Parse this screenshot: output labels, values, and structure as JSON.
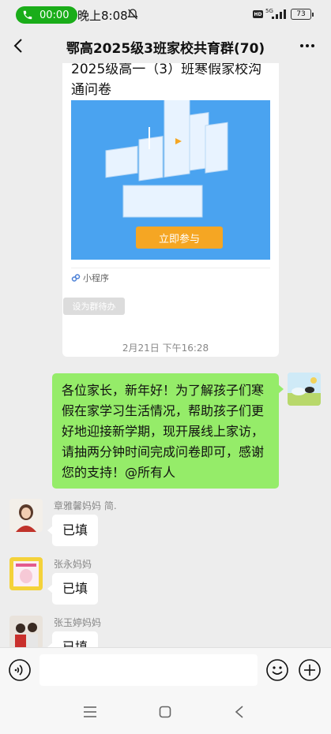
{
  "status_bar": {
    "call_timer": "00:00",
    "time": "晚上8:08",
    "hd": "HD",
    "network": "5G",
    "battery": "73"
  },
  "header": {
    "title": "鄂高2025级3班家校共育群(70)"
  },
  "mini_program": {
    "title": "2025级高一（3）班寒假家校沟通问卷",
    "button_label": "立即参与",
    "footer_label": "小程序",
    "set_todo_label": "设为群待办"
  },
  "timestamp": "2月21日 下午16:28",
  "outgoing_message": "各位家长，新年好！为了解孩子们寒假在家学习生活情况，帮助孩子们更好地迎接新学期，现开展线上家访，请抽两分钟时间完成问卷即可，感谢您的支持！@所有人",
  "messages": [
    {
      "sender": "章雅馨妈妈 简.",
      "text": "已填"
    },
    {
      "sender": "张永妈妈",
      "text": "已填"
    },
    {
      "sender": "张玉婷妈妈",
      "text": "已填"
    }
  ],
  "colors": {
    "call_green": "#1aad19",
    "bubble_green": "#95ec69",
    "banner_blue": "#4aa3f0",
    "button_orange": "#f5a623"
  }
}
